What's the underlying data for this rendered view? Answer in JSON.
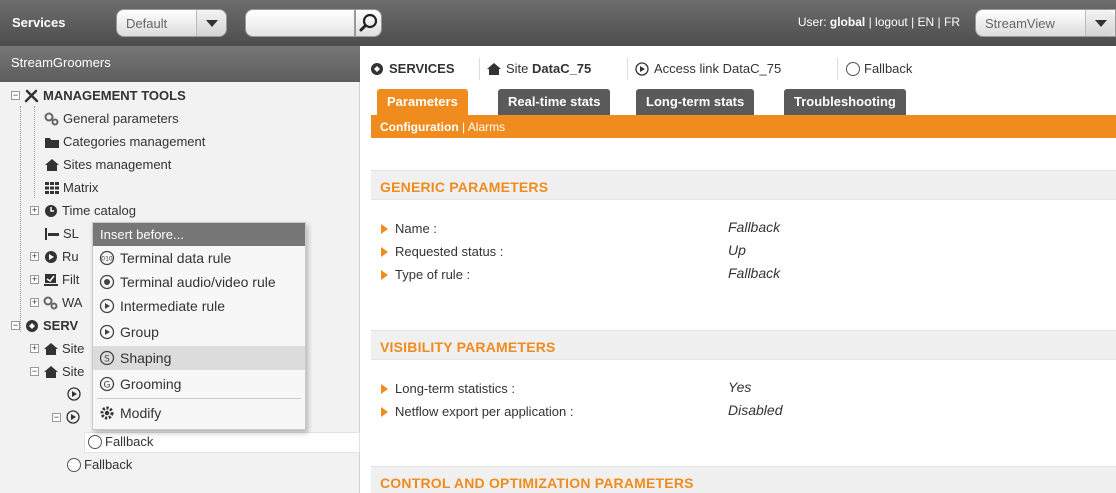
{
  "topbar": {
    "services_label": "Services",
    "profile_value": "Default",
    "search_placeholder": "",
    "user_prefix": "User: ",
    "user_name": "global",
    "logout": "logout",
    "lang_en": "EN",
    "lang_fr": "FR",
    "sep": " | ",
    "view_value": "StreamView"
  },
  "left": {
    "title": "StreamGroomers",
    "tree": {
      "management_tools": "MANAGEMENT TOOLS",
      "general_parameters": "General parameters",
      "categories_management": "Categories management",
      "sites_management": "Sites management",
      "matrix": "Matrix",
      "time_catalog": "Time catalog",
      "sl_item": "SL",
      "ru_item": "Ru",
      "filt_item": "Filt",
      "wa_item": "WA",
      "serv_item": "SERV",
      "site_item_1": "Site",
      "site_item_2": "Site",
      "fallback_child": "Fallback",
      "fallback_root": "Fallback"
    }
  },
  "context_menu": {
    "header": "Insert before...",
    "items": [
      {
        "label": "Terminal data rule",
        "icon": "terminal-data-icon"
      },
      {
        "label": "Terminal audio/video rule",
        "icon": "terminal-av-icon"
      },
      {
        "label": "Intermediate rule",
        "icon": "play-circle-icon"
      },
      {
        "label": "Group",
        "icon": "play-circle-icon"
      },
      {
        "label": "Shaping",
        "icon": "shaping-icon"
      },
      {
        "label": "Grooming",
        "icon": "grooming-icon"
      },
      {
        "label": "Modify",
        "icon": "gear-icon"
      }
    ]
  },
  "breadcrumb": {
    "services": "SERVICES",
    "site_prefix": "Site ",
    "site_name": "DataC_75",
    "access_link": "Access link DataC_75",
    "fallback": "Fallback"
  },
  "tabs": [
    "Parameters",
    "Real-time stats",
    "Long-term stats",
    "Troubleshooting"
  ],
  "subnav": {
    "configuration": "Configuration",
    "sep": " | ",
    "alarms": "Alarms"
  },
  "sections": {
    "generic": {
      "title": "GENERIC PARAMETERS",
      "params": [
        {
          "label": "Name :",
          "value": "Fallback"
        },
        {
          "label": "Requested status :",
          "value": "Up"
        },
        {
          "label": "Type of rule :",
          "value": "Fallback"
        }
      ]
    },
    "visibility": {
      "title": "VISIBILITY PARAMETERS",
      "params": [
        {
          "label": "Long-term statistics :",
          "value": "Yes"
        },
        {
          "label": "Netflow export per application :",
          "value": "Disabled"
        }
      ]
    },
    "control": {
      "title": "CONTROL AND OPTIMIZATION PARAMETERS"
    }
  },
  "colors": {
    "accent": "#f08b1d",
    "dark_bar": "#5a5a5a",
    "panel_bg": "#f2f2f2"
  }
}
